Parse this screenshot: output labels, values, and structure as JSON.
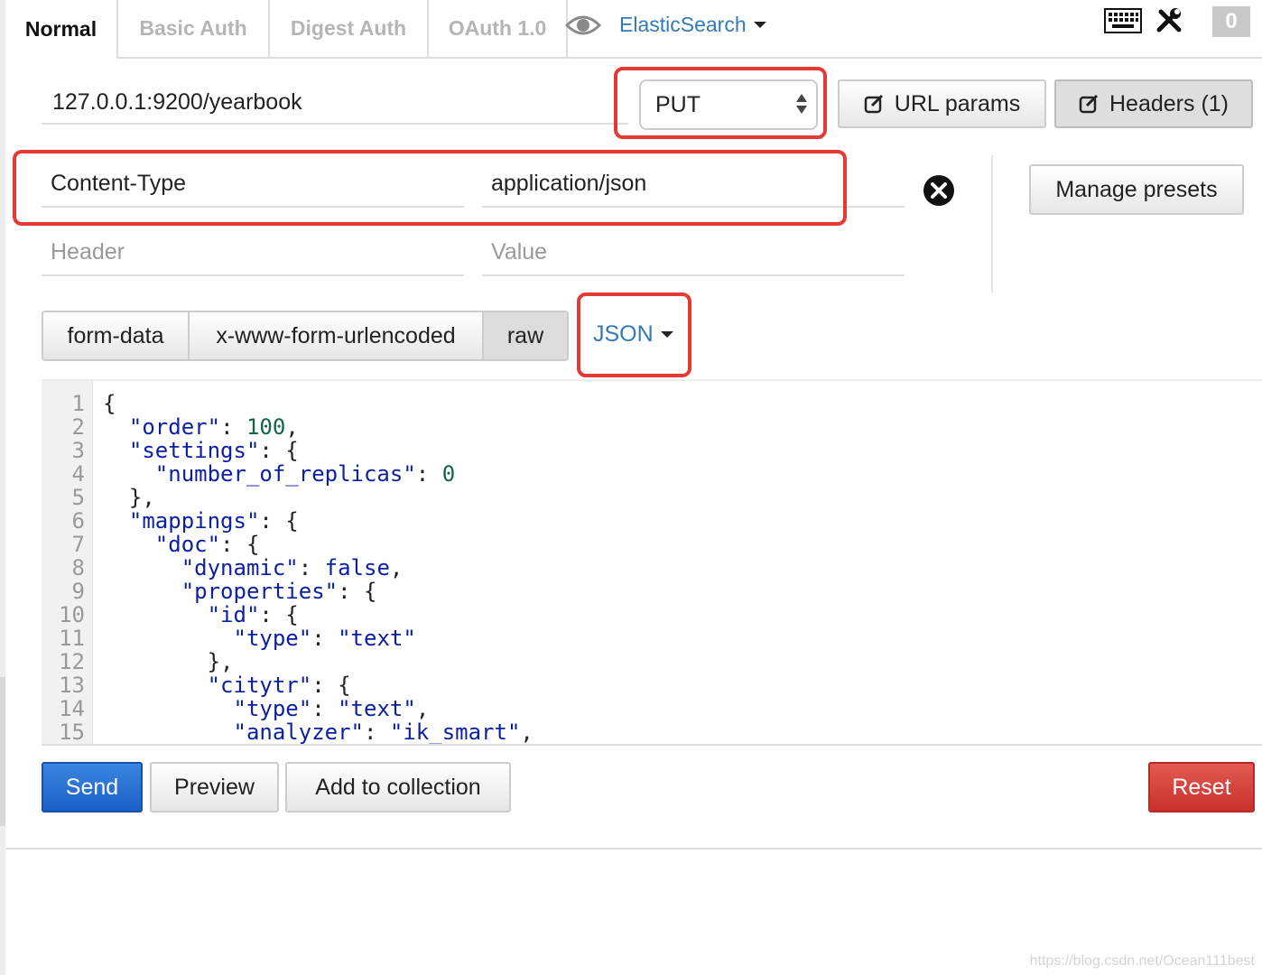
{
  "tabs": [
    {
      "label": "Normal",
      "active": true
    },
    {
      "label": "Basic Auth",
      "active": false
    },
    {
      "label": "Digest Auth",
      "active": false
    },
    {
      "label": "OAuth 1.0",
      "active": false
    }
  ],
  "environment": {
    "label": "ElasticSearch",
    "icon": "eye-icon"
  },
  "toolbar": {
    "keyboard_icon": "keyboard-icon",
    "tools_icon": "tools-icon",
    "badge_count": "0"
  },
  "request": {
    "url": "127.0.0.1:9200/yearbook",
    "method": "PUT",
    "url_params_label": "URL params",
    "headers_label": "Headers (1)"
  },
  "headers": {
    "rows": [
      {
        "name": "Content-Type",
        "value": "application/json"
      }
    ],
    "name_placeholder": "Header",
    "value_placeholder": "Value",
    "manage_presets_label": "Manage presets"
  },
  "body": {
    "types": [
      "form-data",
      "x-www-form-urlencoded",
      "raw"
    ],
    "active_type": "raw",
    "format": "JSON",
    "lines": [
      {
        "n": "1",
        "text": "{"
      },
      {
        "n": "2",
        "text": "  \"order\": 100,"
      },
      {
        "n": "3",
        "text": "  \"settings\": {"
      },
      {
        "n": "4",
        "text": "    \"number_of_replicas\": 0"
      },
      {
        "n": "5",
        "text": "  },"
      },
      {
        "n": "6",
        "text": "  \"mappings\": {"
      },
      {
        "n": "7",
        "text": "    \"doc\": {"
      },
      {
        "n": "8",
        "text": "      \"dynamic\": false,"
      },
      {
        "n": "9",
        "text": "      \"properties\": {"
      },
      {
        "n": "10",
        "text": "        \"id\": {"
      },
      {
        "n": "11",
        "text": "          \"type\": \"text\""
      },
      {
        "n": "12",
        "text": "        },"
      },
      {
        "n": "13",
        "text": "        \"citytr\": {"
      },
      {
        "n": "14",
        "text": "          \"type\": \"text\","
      },
      {
        "n": "15",
        "text": "          \"analyzer\": \"ik_smart\","
      }
    ]
  },
  "actions": {
    "send_label": "Send",
    "preview_label": "Preview",
    "add_collection_label": "Add to collection",
    "reset_label": "Reset"
  },
  "watermark": "https://blog.csdn.net/Ocean111best",
  "colors": {
    "highlight": "#e53935",
    "link": "#337ab7",
    "send": "#1a5fc7",
    "reset": "#c9302c"
  }
}
